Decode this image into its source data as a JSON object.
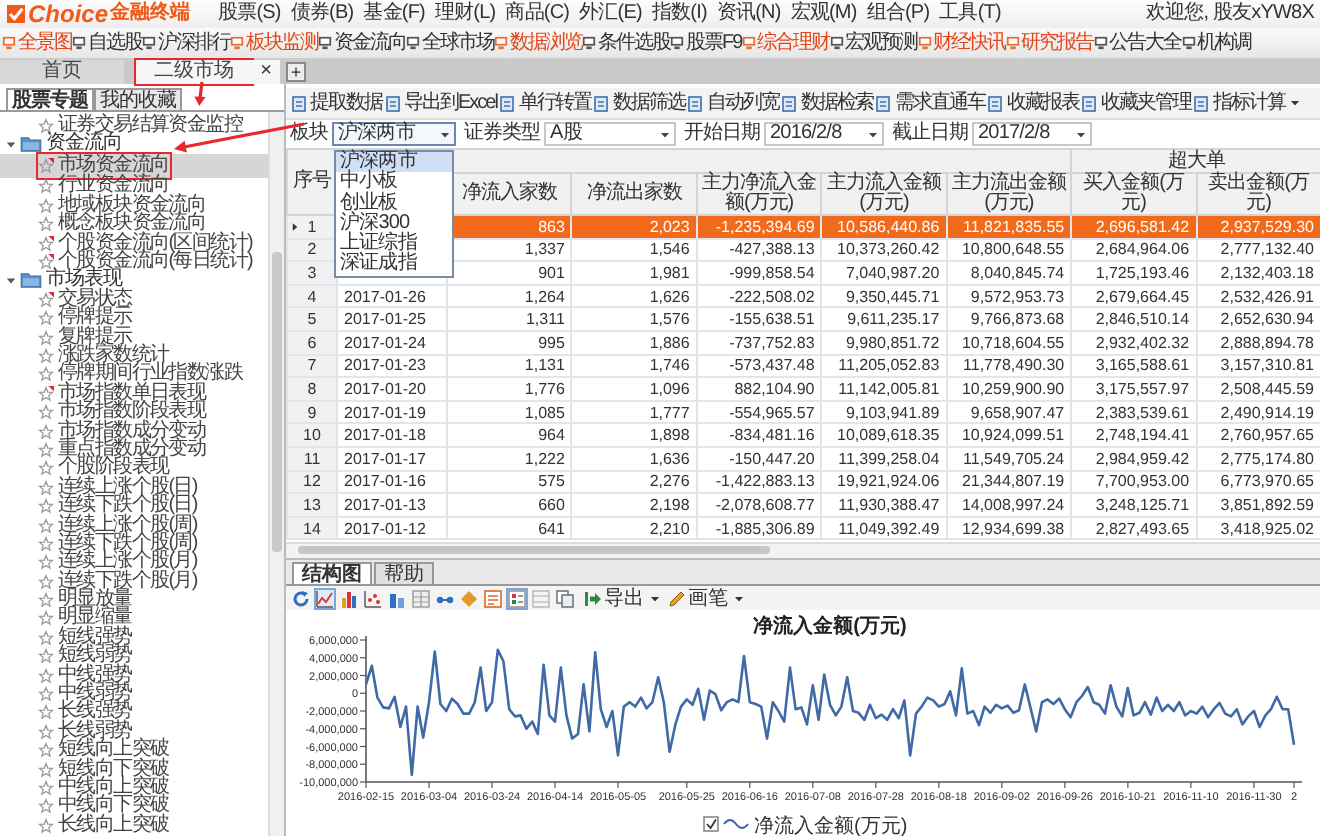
{
  "app": {
    "logo": {
      "brand": "Choice",
      "name": "金融终端"
    },
    "menu": [
      "股票(S)",
      "债券(B)",
      "基金(F)",
      "理财(L)",
      "商品(C)",
      "外汇(E)",
      "指数(I)",
      "资讯(N)",
      "宏观(M)",
      "组合(P)",
      "工具(T)"
    ],
    "greeting": "欢迎您, 股友xYW8X"
  },
  "toolbar": [
    {
      "label": "全景图",
      "highlighted": true
    },
    {
      "label": "自选股",
      "highlighted": false
    },
    {
      "label": "沪深排行",
      "highlighted": false
    },
    {
      "label": "板块监测",
      "highlighted": true
    },
    {
      "label": "资金流向",
      "highlighted": false
    },
    {
      "label": "全球市场",
      "highlighted": false
    },
    {
      "label": "数据浏览",
      "highlighted": true
    },
    {
      "label": "条件选股",
      "highlighted": false
    },
    {
      "label": "股票F9",
      "highlighted": false
    },
    {
      "label": "综合理财",
      "highlighted": true
    },
    {
      "label": "宏观预测",
      "highlighted": false
    },
    {
      "label": "财经快讯",
      "highlighted": true
    },
    {
      "label": "研究报告",
      "highlighted": true
    },
    {
      "label": "公告大全",
      "highlighted": false
    },
    {
      "label": "机构调",
      "highlighted": false
    }
  ],
  "tabs": [
    {
      "label": "首页",
      "selected": false,
      "annotated": false
    },
    {
      "label": "二级市场",
      "selected": true,
      "annotated": true,
      "close": "×"
    }
  ],
  "new_tab": "+",
  "sidebar": {
    "tabs": [
      {
        "label": "股票专题",
        "selected": true
      },
      {
        "label": "我的收藏",
        "selected": false
      }
    ],
    "tree": [
      {
        "kind": "folder",
        "children": [
          {
            "label": "证券交易结算资金监控",
            "marked": false,
            "selected": false,
            "annotated": false
          }
        ]
      },
      {
        "kind": "folder",
        "label": "资金流向",
        "expanded": true,
        "children": [
          {
            "label": "市场资金流向",
            "marked": true,
            "selected": true,
            "annotated": true
          },
          {
            "label": "行业资金流向",
            "marked": false,
            "selected": false,
            "annotated": false
          },
          {
            "label": "地域板块资金流向",
            "marked": false,
            "selected": false,
            "annotated": false
          },
          {
            "label": "概念板块资金流向",
            "marked": false,
            "selected": false,
            "annotated": false
          },
          {
            "label": "个股资金流向(区间统计)",
            "marked": true,
            "selected": false,
            "annotated": false
          },
          {
            "label": "个股资金流向(每日统计)",
            "marked": true,
            "selected": false,
            "annotated": false
          }
        ]
      },
      {
        "kind": "folder",
        "label": "市场表现",
        "expanded": true,
        "children": [
          {
            "label": "交易状态",
            "marked": true,
            "selected": false,
            "annotated": false
          },
          {
            "label": "停牌提示",
            "marked": false,
            "selected": false,
            "annotated": false
          },
          {
            "label": "复牌提示",
            "marked": false,
            "selected": false,
            "annotated": false
          },
          {
            "label": "涨跌家数统计",
            "marked": false,
            "selected": false,
            "annotated": false
          },
          {
            "label": "停牌期间行业指数涨跌",
            "marked": false,
            "selected": false,
            "annotated": false
          },
          {
            "label": "市场指数单日表现",
            "marked": true,
            "selected": false,
            "annotated": false
          },
          {
            "label": "市场指数阶段表现",
            "marked": false,
            "selected": false,
            "annotated": false
          },
          {
            "label": "市场指数成分变动",
            "marked": false,
            "selected": false,
            "annotated": false
          },
          {
            "label": "重点指数成分变动",
            "marked": false,
            "selected": false,
            "annotated": false
          },
          {
            "label": "个股阶段表现",
            "marked": false,
            "selected": false,
            "annotated": false
          },
          {
            "label": "连续上涨个股(日)",
            "marked": false,
            "selected": false,
            "annotated": false
          },
          {
            "label": "连续下跌个股(日)",
            "marked": false,
            "selected": false,
            "annotated": false
          },
          {
            "label": "连续上涨个股(周)",
            "marked": false,
            "selected": false,
            "annotated": false
          },
          {
            "label": "连续下跌个股(周)",
            "marked": false,
            "selected": false,
            "annotated": false
          },
          {
            "label": "连续上涨个股(月)",
            "marked": false,
            "selected": false,
            "annotated": false
          },
          {
            "label": "连续下跌个股(月)",
            "marked": false,
            "selected": false,
            "annotated": false
          },
          {
            "label": "明显放量",
            "marked": false,
            "selected": false,
            "annotated": false
          },
          {
            "label": "明显缩量",
            "marked": false,
            "selected": false,
            "annotated": false
          },
          {
            "label": "短线强势",
            "marked": false,
            "selected": false,
            "annotated": false
          },
          {
            "label": "短线弱势",
            "marked": false,
            "selected": false,
            "annotated": false
          },
          {
            "label": "中线强势",
            "marked": false,
            "selected": false,
            "annotated": false
          },
          {
            "label": "中线弱势",
            "marked": false,
            "selected": false,
            "annotated": false
          },
          {
            "label": "长线强势",
            "marked": false,
            "selected": false,
            "annotated": false
          },
          {
            "label": "长线弱势",
            "marked": false,
            "selected": false,
            "annotated": false
          },
          {
            "label": "短线向上突破",
            "marked": false,
            "selected": false,
            "annotated": false
          },
          {
            "label": "短线向下突破",
            "marked": false,
            "selected": false,
            "annotated": false
          },
          {
            "label": "中线向上突破",
            "marked": false,
            "selected": false,
            "annotated": false
          },
          {
            "label": "中线向下突破",
            "marked": false,
            "selected": false,
            "annotated": false
          },
          {
            "label": "长线向上突破",
            "marked": false,
            "selected": false,
            "annotated": false
          }
        ]
      }
    ]
  },
  "actions": [
    {
      "label": "提取数据"
    },
    {
      "label": "导出到Excel"
    },
    {
      "label": "单行转置"
    },
    {
      "label": "数据筛选"
    },
    {
      "label": "自动列宽"
    },
    {
      "label": "数据检索"
    },
    {
      "label": "需求直通车"
    },
    {
      "label": "收藏报表"
    },
    {
      "label": "收藏夹管理"
    },
    {
      "label": "指标计算",
      "menu": true
    }
  ],
  "filters": [
    {
      "label": "板块",
      "value": "沪深两市",
      "open": true,
      "options": [
        {
          "label": "沪深两市",
          "selected": true
        },
        {
          "label": "中小板",
          "selected": false
        },
        {
          "label": "创业板",
          "selected": false
        },
        {
          "label": "沪深300",
          "selected": false
        },
        {
          "label": "上证综指",
          "selected": false
        },
        {
          "label": "深证成指",
          "selected": false
        }
      ]
    },
    {
      "label": "证券类型",
      "value": "A股",
      "open": false
    },
    {
      "label": "开始日期",
      "value": "2016/2/8",
      "open": false
    },
    {
      "label": "截止日期",
      "value": "2017/2/8",
      "open": false
    }
  ],
  "table": {
    "index_header": "序号",
    "columns": [
      {
        "label": "净流入家数"
      },
      {
        "label": "净流出家数"
      },
      {
        "label": "主力净流入金额(万元)"
      },
      {
        "label": "主力流入金额(万元)"
      },
      {
        "label": "主力流出金额(万元)"
      }
    ],
    "column_group": {
      "label": "超大单",
      "columns": [
        {
          "label": "买入金额(万元)"
        },
        {
          "label": "卖出金额(万元)"
        }
      ]
    },
    "rows": [
      {
        "no": "1",
        "selected": true,
        "values": [
          "863",
          "2,023",
          "-1,235,394.69",
          "10,586,440.86",
          "11,821,835.55",
          "2,696,581.42",
          "2,937,529.30"
        ]
      },
      {
        "no": "2",
        "selected": false,
        "values": [
          "1,337",
          "1,546",
          "-427,388.13",
          "10,373,260.42",
          "10,800,648.55",
          "2,684,964.06",
          "2,777,132.40"
        ]
      },
      {
        "no": "3",
        "selected": false,
        "values": [
          "901",
          "1,981",
          "-999,858.54",
          "7,040,987.20",
          "8,040,845.74",
          "1,725,193.46",
          "2,132,403.18"
        ]
      },
      {
        "no": "4",
        "date": "2017-01-26",
        "selected": false,
        "values": [
          "1,264",
          "1,626",
          "-222,508.02",
          "9,350,445.71",
          "9,572,953.73",
          "2,679,664.45",
          "2,532,426.91"
        ]
      },
      {
        "no": "5",
        "date": "2017-01-25",
        "selected": false,
        "values": [
          "1,311",
          "1,576",
          "-155,638.51",
          "9,611,235.17",
          "9,766,873.68",
          "2,846,510.14",
          "2,652,630.94"
        ]
      },
      {
        "no": "6",
        "date": "2017-01-24",
        "selected": false,
        "values": [
          "995",
          "1,886",
          "-737,752.83",
          "9,980,851.72",
          "10,718,604.55",
          "2,932,402.32",
          "2,888,894.78"
        ]
      },
      {
        "no": "7",
        "date": "2017-01-23",
        "selected": false,
        "values": [
          "1,131",
          "1,746",
          "-573,437.48",
          "11,205,052.83",
          "11,778,490.30",
          "3,165,588.61",
          "3,157,310.81"
        ]
      },
      {
        "no": "8",
        "date": "2017-01-20",
        "selected": false,
        "values": [
          "1,776",
          "1,096",
          "882,104.90",
          "11,142,005.81",
          "10,259,900.90",
          "3,175,557.97",
          "2,508,445.59"
        ]
      },
      {
        "no": "9",
        "date": "2017-01-19",
        "selected": false,
        "values": [
          "1,085",
          "1,777",
          "-554,965.57",
          "9,103,941.89",
          "9,658,907.47",
          "2,383,539.61",
          "2,490,914.19"
        ]
      },
      {
        "no": "10",
        "date": "2017-01-18",
        "selected": false,
        "values": [
          "964",
          "1,898",
          "-834,481.16",
          "10,089,618.35",
          "10,924,099.51",
          "2,748,194.41",
          "2,760,957.65"
        ]
      },
      {
        "no": "11",
        "date": "2017-01-17",
        "selected": false,
        "values": [
          "1,222",
          "1,636",
          "-150,447.20",
          "11,399,258.04",
          "11,549,705.24",
          "2,984,959.42",
          "2,775,174.80"
        ]
      },
      {
        "no": "12",
        "date": "2017-01-16",
        "selected": false,
        "values": [
          "575",
          "2,276",
          "-1,422,883.13",
          "19,921,924.06",
          "21,344,807.19",
          "7,700,953.00",
          "6,773,970.65"
        ]
      },
      {
        "no": "13",
        "date": "2017-01-13",
        "selected": false,
        "values": [
          "660",
          "2,198",
          "-2,078,608.77",
          "11,930,388.47",
          "14,008,997.24",
          "3,248,125.71",
          "3,851,892.59"
        ]
      },
      {
        "no": "14",
        "date": "2017-01-12",
        "selected": false,
        "values": [
          "641",
          "2,210",
          "-1,885,306.89",
          "11,049,392.49",
          "12,934,699.38",
          "2,827,493.65",
          "3,418,925.02"
        ]
      }
    ]
  },
  "bottom_panel": {
    "tabs": [
      {
        "label": "结构图",
        "selected": true
      },
      {
        "label": "帮助",
        "selected": false
      }
    ],
    "tools": [
      {
        "kind": "refresh",
        "selected": false
      },
      {
        "kind": "line",
        "selected": true
      },
      {
        "kind": "bar",
        "selected": false
      },
      {
        "kind": "scatter",
        "selected": false
      },
      {
        "kind": "column",
        "selected": false
      },
      {
        "kind": "table",
        "selected": false
      },
      {
        "kind": "link",
        "selected": false
      },
      {
        "kind": "tag",
        "selected": false
      },
      {
        "kind": "panel",
        "selected": false
      },
      {
        "kind": "legend",
        "selected": true
      },
      {
        "kind": "grid",
        "selected": false
      },
      {
        "kind": "copy",
        "selected": false
      }
    ],
    "export": "导出",
    "pen": "画笔",
    "x_axis_labels": [
      "2016-02-15",
      "2016-03-04",
      "2016-03-24",
      "2016-04-14",
      "2016-05-05",
      "2016-05-25",
      "2016-06-16",
      "2016-07-08",
      "2016-07-28",
      "2016-08-18",
      "2016-09-02",
      "2016-09-26",
      "2016-10-21",
      "2016-11-10",
      "2016-11-30",
      "2"
    ],
    "legend": {
      "checked": true
    },
    "chart_data": {
      "type": "line",
      "title": "净流入金额(万元)",
      "ylim": [
        -10000000,
        6000000
      ],
      "yticks": [
        {
          "value": 6000000,
          "label": "6,000,000"
        },
        {
          "value": 4000000,
          "label": "4,000,000"
        },
        {
          "value": 2000000,
          "label": "2,000,000"
        },
        {
          "value": 0,
          "label": "0"
        },
        {
          "value": -2000000,
          "label": "-2,000,000"
        },
        {
          "value": -4000000,
          "label": "-4,000,000"
        },
        {
          "value": -6000000,
          "label": "-6,000,000"
        },
        {
          "value": -8000000,
          "label": "-8,000,000"
        },
        {
          "value": -10000000,
          "label": "-10,000,000"
        }
      ],
      "series": [
        {
          "name": "净流入金额(万元)",
          "color": "#3f6aa6",
          "values": [
            1000000,
            3100000,
            -500000,
            -1600000,
            -1700000,
            -400000,
            -3800000,
            -1500000,
            -9200000,
            -1500000,
            -5000000,
            -1000000,
            4700000,
            -1200000,
            -2000000,
            -600000,
            -1200000,
            -2300000,
            -2300000,
            -1000000,
            2900000,
            -2000000,
            -1000000,
            4900000,
            3600000,
            -1800000,
            -2600000,
            -2500000,
            -4000000,
            -3200000,
            -4600000,
            3200000,
            -2500000,
            -3200000,
            2900000,
            -2500000,
            -5100000,
            -4600000,
            1000000,
            -4300000,
            4600000,
            -1800000,
            -3800000,
            -2000000,
            -7000000,
            -1500000,
            -1000000,
            -1500000,
            -500000,
            -1700000,
            -1000000,
            1800000,
            -1000000,
            -6600000,
            -3500000,
            -1500000,
            -700000,
            -1300000,
            500000,
            -3000000,
            300000,
            -100000,
            -1900000,
            -1000000,
            -700000,
            -1000000,
            4200000,
            -1000000,
            -1200000,
            -1500000,
            -5100000,
            -1000000,
            -2000000,
            -3200000,
            2900000,
            -1800000,
            -1600000,
            -3500000,
            900000,
            -3000000,
            2100000,
            -1300000,
            -2500000,
            -1500000,
            1800000,
            -2000000,
            -2200000,
            -3000000,
            -1300000,
            -2800000,
            -2400000,
            -3000000,
            -1800000,
            -2800000,
            -800000,
            -7000000,
            -2300000,
            -1500000,
            -500000,
            -800000,
            -1500000,
            -1200000,
            200000,
            -2500000,
            2800000,
            -2300000,
            -2000000,
            -3600000,
            -1500000,
            -2200000,
            -1300000,
            -1700000,
            -1400000,
            -2200000,
            -1900000,
            1000000,
            -1600000,
            -4300000,
            -1000000,
            -700000,
            -1200000,
            -600000,
            -1800000,
            -2700000,
            -1000000,
            -300000,
            700000,
            -1000000,
            -1300000,
            -2300000,
            900000,
            -1500000,
            -2600000,
            600000,
            -2500000,
            -2200000,
            -1000000,
            -2400000,
            -500000,
            -2000000,
            -1300000,
            -2000000,
            -1000000,
            -2500000,
            -2000000,
            -2300000,
            -1500000,
            -2700000,
            -1800000,
            -1100000,
            -2300000,
            -2600000,
            -1800000,
            -3500000,
            -2600000,
            -2000000,
            -3800000,
            -2500000,
            -1800000,
            -400000,
            -1800000,
            -1800000,
            -5800000
          ]
        }
      ]
    }
  }
}
